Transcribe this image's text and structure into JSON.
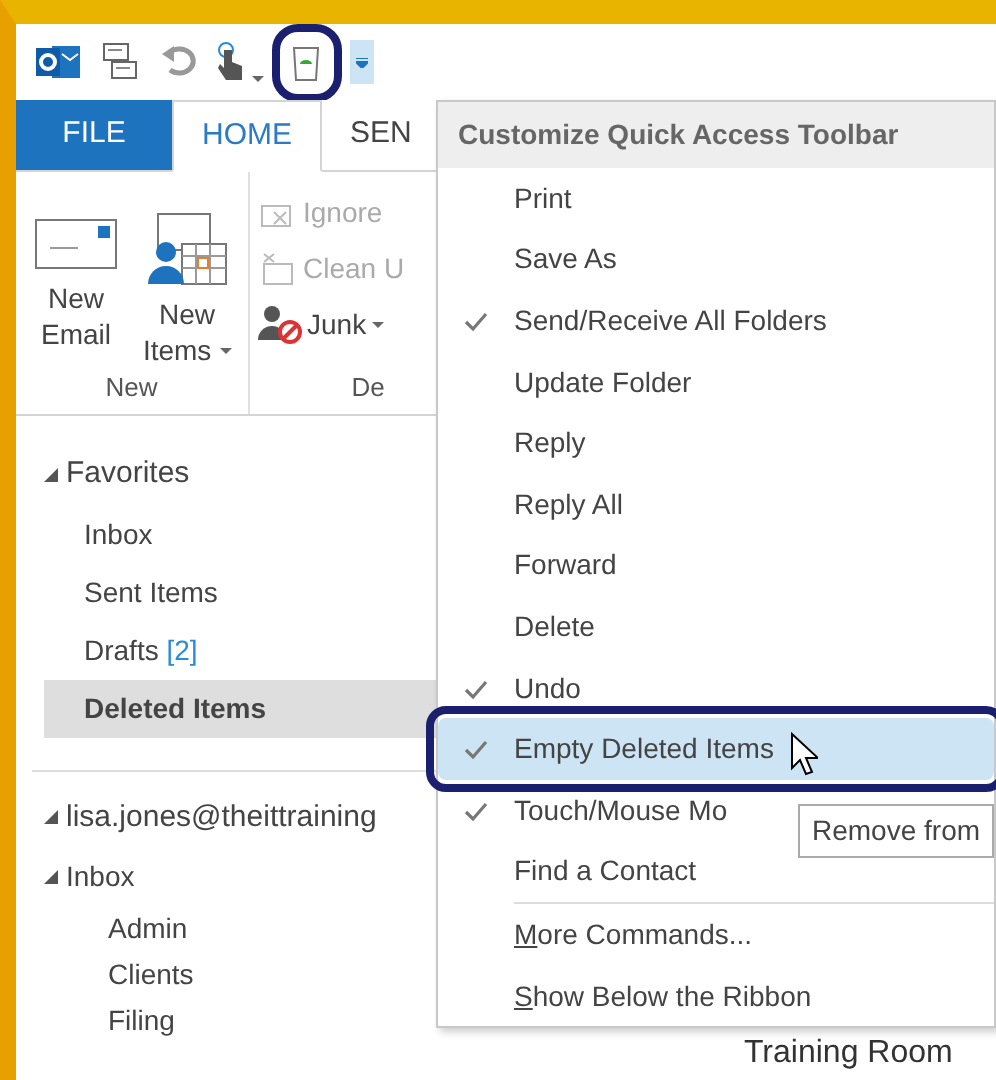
{
  "quick_access": {
    "empty_button_annotated": true,
    "customize_open": true
  },
  "ribbon_tabs": [
    {
      "label": "FILE",
      "kind": "file",
      "selected": false
    },
    {
      "label": "HOME",
      "kind": "tab",
      "selected": true
    },
    {
      "label": "SEN",
      "kind": "tab",
      "selected": false
    }
  ],
  "ribbon": {
    "groups": [
      {
        "label": "New",
        "kind": "large",
        "buttons": [
          {
            "label": "New Email",
            "kind": "email",
            "dropdown": false
          },
          {
            "label": "New Items",
            "kind": "items",
            "dropdown": true
          }
        ]
      },
      {
        "label": "De",
        "kind": "small",
        "buttons": [
          {
            "label": "Ignore",
            "kind": "ignore",
            "dropdown": false,
            "disabled": true
          },
          {
            "label": "Clean U",
            "kind": "clean",
            "dropdown": false,
            "disabled": true
          },
          {
            "label": "Junk",
            "kind": "junk",
            "dropdown": true,
            "disabled": false
          }
        ]
      }
    ]
  },
  "navigation": {
    "favorites": {
      "label": "Favorites",
      "expanded": true,
      "items": [
        {
          "label": "Inbox",
          "selected": false
        },
        {
          "label": "Sent Items",
          "selected": false
        },
        {
          "label": "Drafts",
          "count": "[2]",
          "selected": false
        },
        {
          "label": "Deleted Items",
          "selected": true
        }
      ]
    },
    "account": {
      "label": "lisa.jones@theittraining",
      "expanded": true,
      "children": [
        {
          "label": "Inbox",
          "expanded": true,
          "children": [
            {
              "label": "Admin"
            },
            {
              "label": "Clients"
            },
            {
              "label": "Filing"
            }
          ]
        }
      ]
    }
  },
  "menu": {
    "title": "Customize Quick Access Toolbar",
    "commands": [
      {
        "label": "Print",
        "checked": false,
        "highlighted": false,
        "annotated": false
      },
      {
        "label": "Save As",
        "checked": false,
        "highlighted": false,
        "annotated": false
      },
      {
        "label": "Send/Receive All Folders",
        "checked": true,
        "highlighted": false,
        "annotated": false
      },
      {
        "label": "Update Folder",
        "checked": false,
        "highlighted": false,
        "annotated": false
      },
      {
        "label": "Reply",
        "checked": false,
        "highlighted": false,
        "annotated": false
      },
      {
        "label": "Reply All",
        "checked": false,
        "highlighted": false,
        "annotated": false
      },
      {
        "label": "Forward",
        "checked": false,
        "highlighted": false,
        "annotated": false
      },
      {
        "label": "Delete",
        "checked": false,
        "highlighted": false,
        "annotated": false
      },
      {
        "label": "Undo",
        "checked": true,
        "highlighted": false,
        "annotated": false
      },
      {
        "label": "Empty Deleted Items",
        "checked": true,
        "highlighted": true,
        "annotated": true
      },
      {
        "label": "Touch/Mouse Mo",
        "checked": true,
        "highlighted": false,
        "annotated": false
      },
      {
        "label": "Find a Contact",
        "checked": false,
        "highlighted": false,
        "annotated": false
      }
    ],
    "extras": [
      {
        "label": "More Commands..."
      },
      {
        "label": "Show Below the Ribbon"
      }
    ]
  },
  "tooltip": "Remove from",
  "reading_pane": {
    "text": "Training Room"
  }
}
